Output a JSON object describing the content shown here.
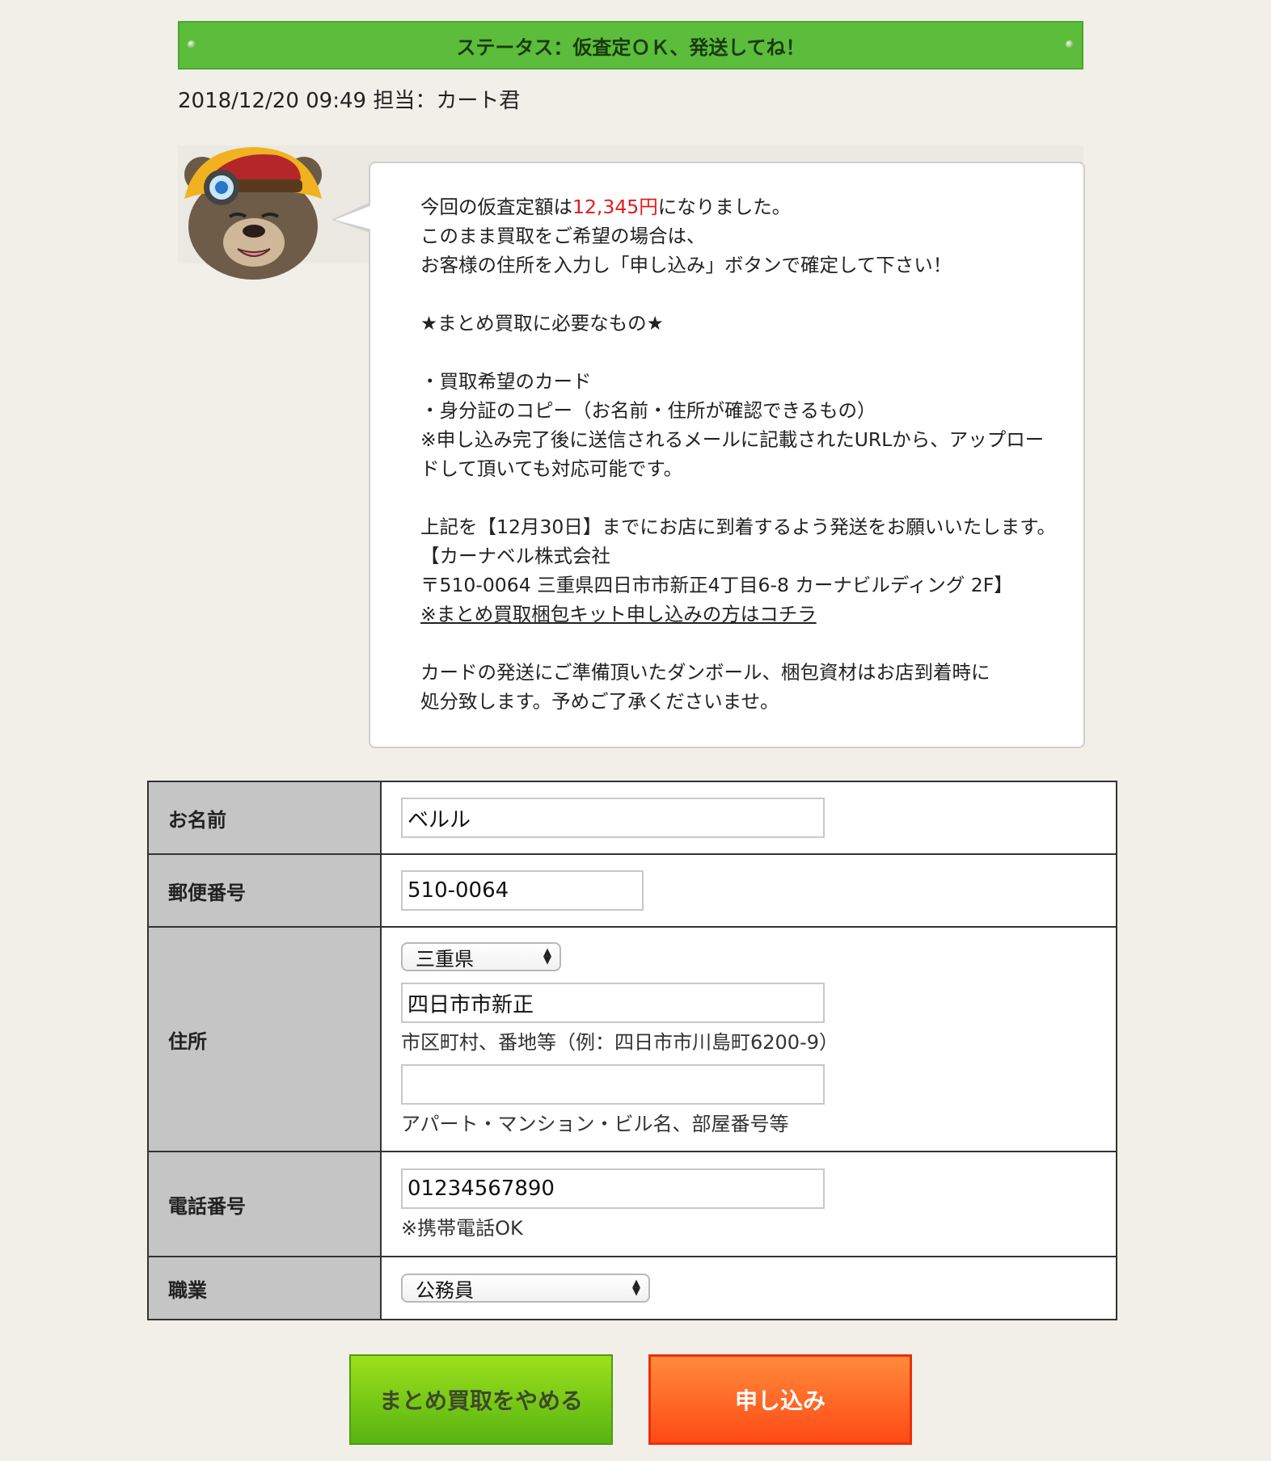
{
  "status": {
    "text": "ステータス：仮査定ＯＫ、発送してね！",
    "color": "#5bbd3b"
  },
  "meta": {
    "datetime": "2018/12/20 09:49",
    "staff": "担当：カート君"
  },
  "avatar": {
    "icon": "bear-mascot-icon"
  },
  "message": {
    "price_prefix": "今回の仮査定額は",
    "price": "12,345円",
    "price_suffix": "になりました。",
    "line2": "このまま買取をご希望の場合は、",
    "line3": "お客様の住所を入力し「申し込み」ボタンで確定して下さい！",
    "needs_heading": "★まとめ買取に必要なもの★",
    "item1": "・買取希望のカード",
    "item2": "・身分証のコピー（お名前・住所が確認できるもの）",
    "note1": "※申し込み完了後に送信されるメールに記載されたURLから、アップロー",
    "note2": "ドして頂いても対応可能です。",
    "deadline": "上記を【12月30日】までにお店に到着するよう発送をお願いいたします。",
    "company": "【カーナベル株式会社",
    "address": "〒510-0064 三重県四日市市新正4丁目6-8 カーナビルディング 2F】",
    "kit_link": "※まとめ買取梱包キット申し込みの方はコチラ",
    "disposal1": "カードの発送にご準備頂いたダンボール、梱包資材はお店到着時に",
    "disposal2": "処分致します。予めご了承くださいませ。",
    "price_color": "#e31b1b"
  },
  "form": {
    "name": {
      "label": "お名前",
      "value": "ベルル"
    },
    "postal": {
      "label": "郵便番号",
      "value": "510-0064"
    },
    "address": {
      "label": "住所",
      "prefecture": "三重県",
      "city_value": "四日市市新正",
      "city_hint": "市区町村、番地等（例：四日市市川島町6200-9）",
      "building_value": "",
      "building_hint": "アパート・マンション・ビル名、部屋番号等"
    },
    "phone": {
      "label": "電話番号",
      "value": "01234567890",
      "hint": "※携帯電話OK"
    },
    "job": {
      "label": "職業",
      "value": "公務員"
    }
  },
  "buttons": {
    "cancel": "まとめ買取をやめる",
    "apply": "申し込み",
    "cancel_color": "#58b411",
    "apply_color": "#ff4a16"
  }
}
